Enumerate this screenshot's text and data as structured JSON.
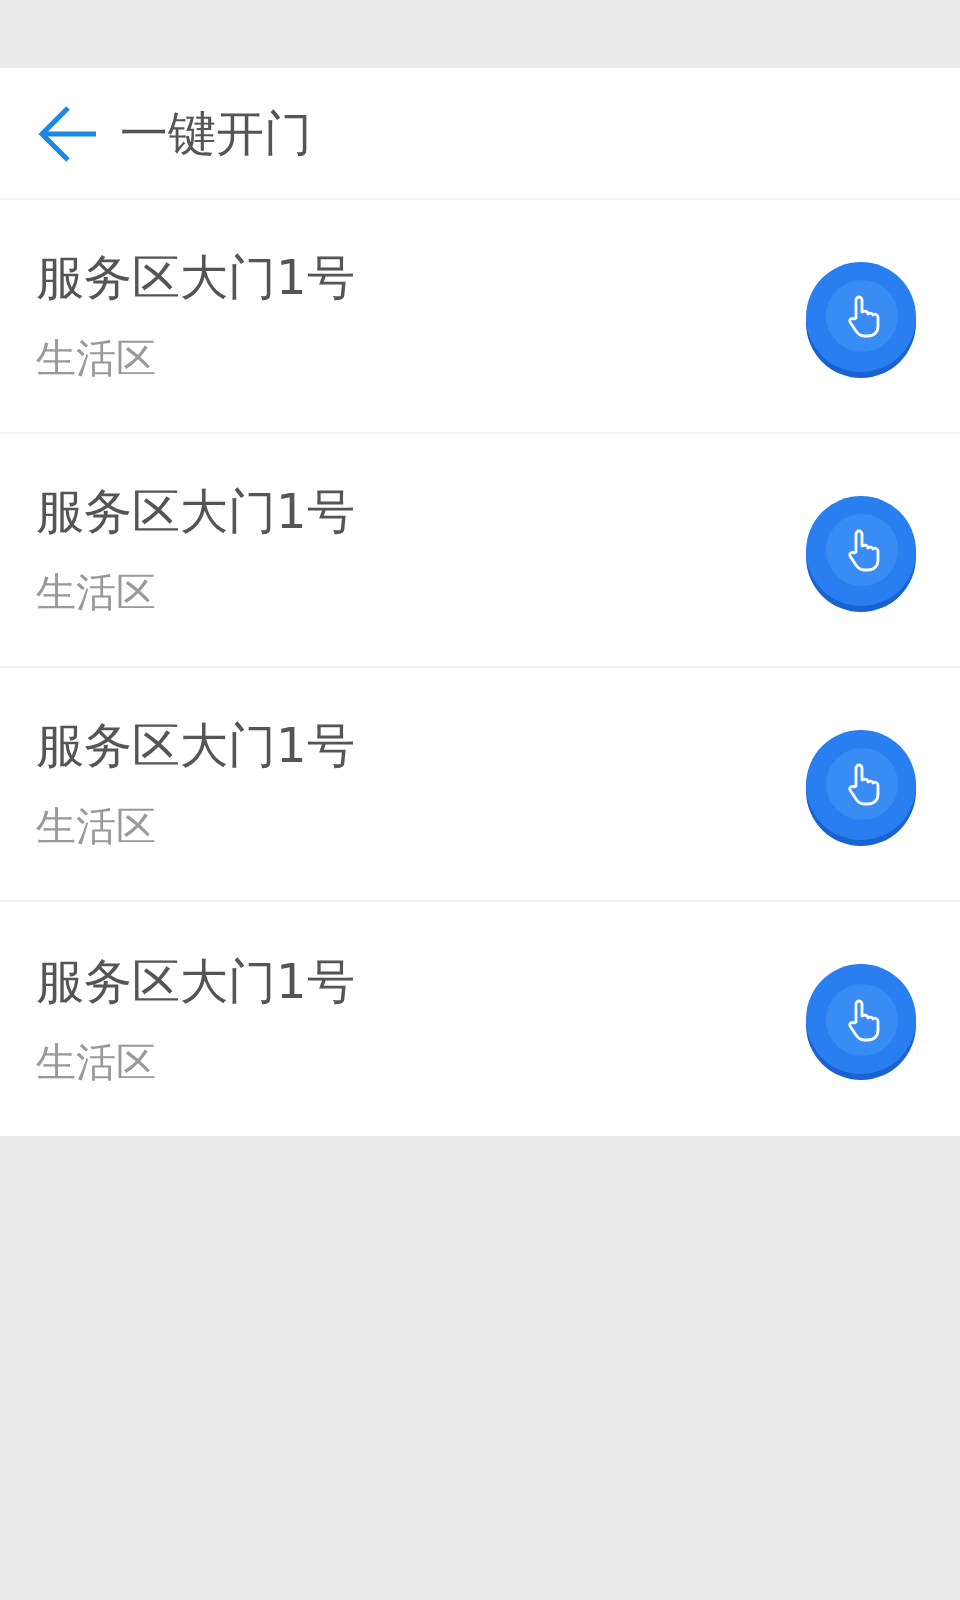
{
  "header": {
    "title": "一键开门"
  },
  "doors": [
    {
      "name": "服务区大门1号",
      "area": "生活区"
    },
    {
      "name": "服务区大门1号",
      "area": "生活区"
    },
    {
      "name": "服务区大门1号",
      "area": "生活区"
    },
    {
      "name": "服务区大门1号",
      "area": "生活区"
    }
  ]
}
